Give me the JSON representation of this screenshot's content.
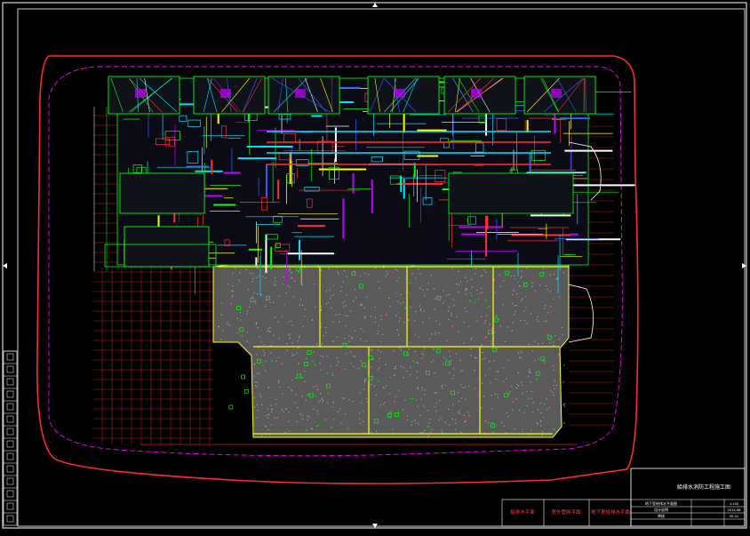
{
  "drawing": {
    "background": "#000000",
    "colors": {
      "frame": "#ffffff",
      "boundary": "#ff2a2a",
      "site_line": "#ff00ff",
      "pipe_cyan": "#00e5ff",
      "pipe_red": "#ff3030",
      "wall_green": "#00ff00",
      "column_yellow": "#ffff00",
      "hatch_gray": "#8a8a8a",
      "dim_red": "#c02020",
      "purple": "#c000ff",
      "blue": "#3060ff"
    }
  },
  "title_block": {
    "main_title": "給排水消防工程施工图",
    "stamps": [
      "給排水平面",
      "室外管网平面",
      "地下室给排水平面"
    ],
    "rows": [
      "地下室给排水平面图",
      "设计说明",
      "审核"
    ],
    "small": [
      "1:100",
      "2015.08",
      "SS-01"
    ]
  }
}
